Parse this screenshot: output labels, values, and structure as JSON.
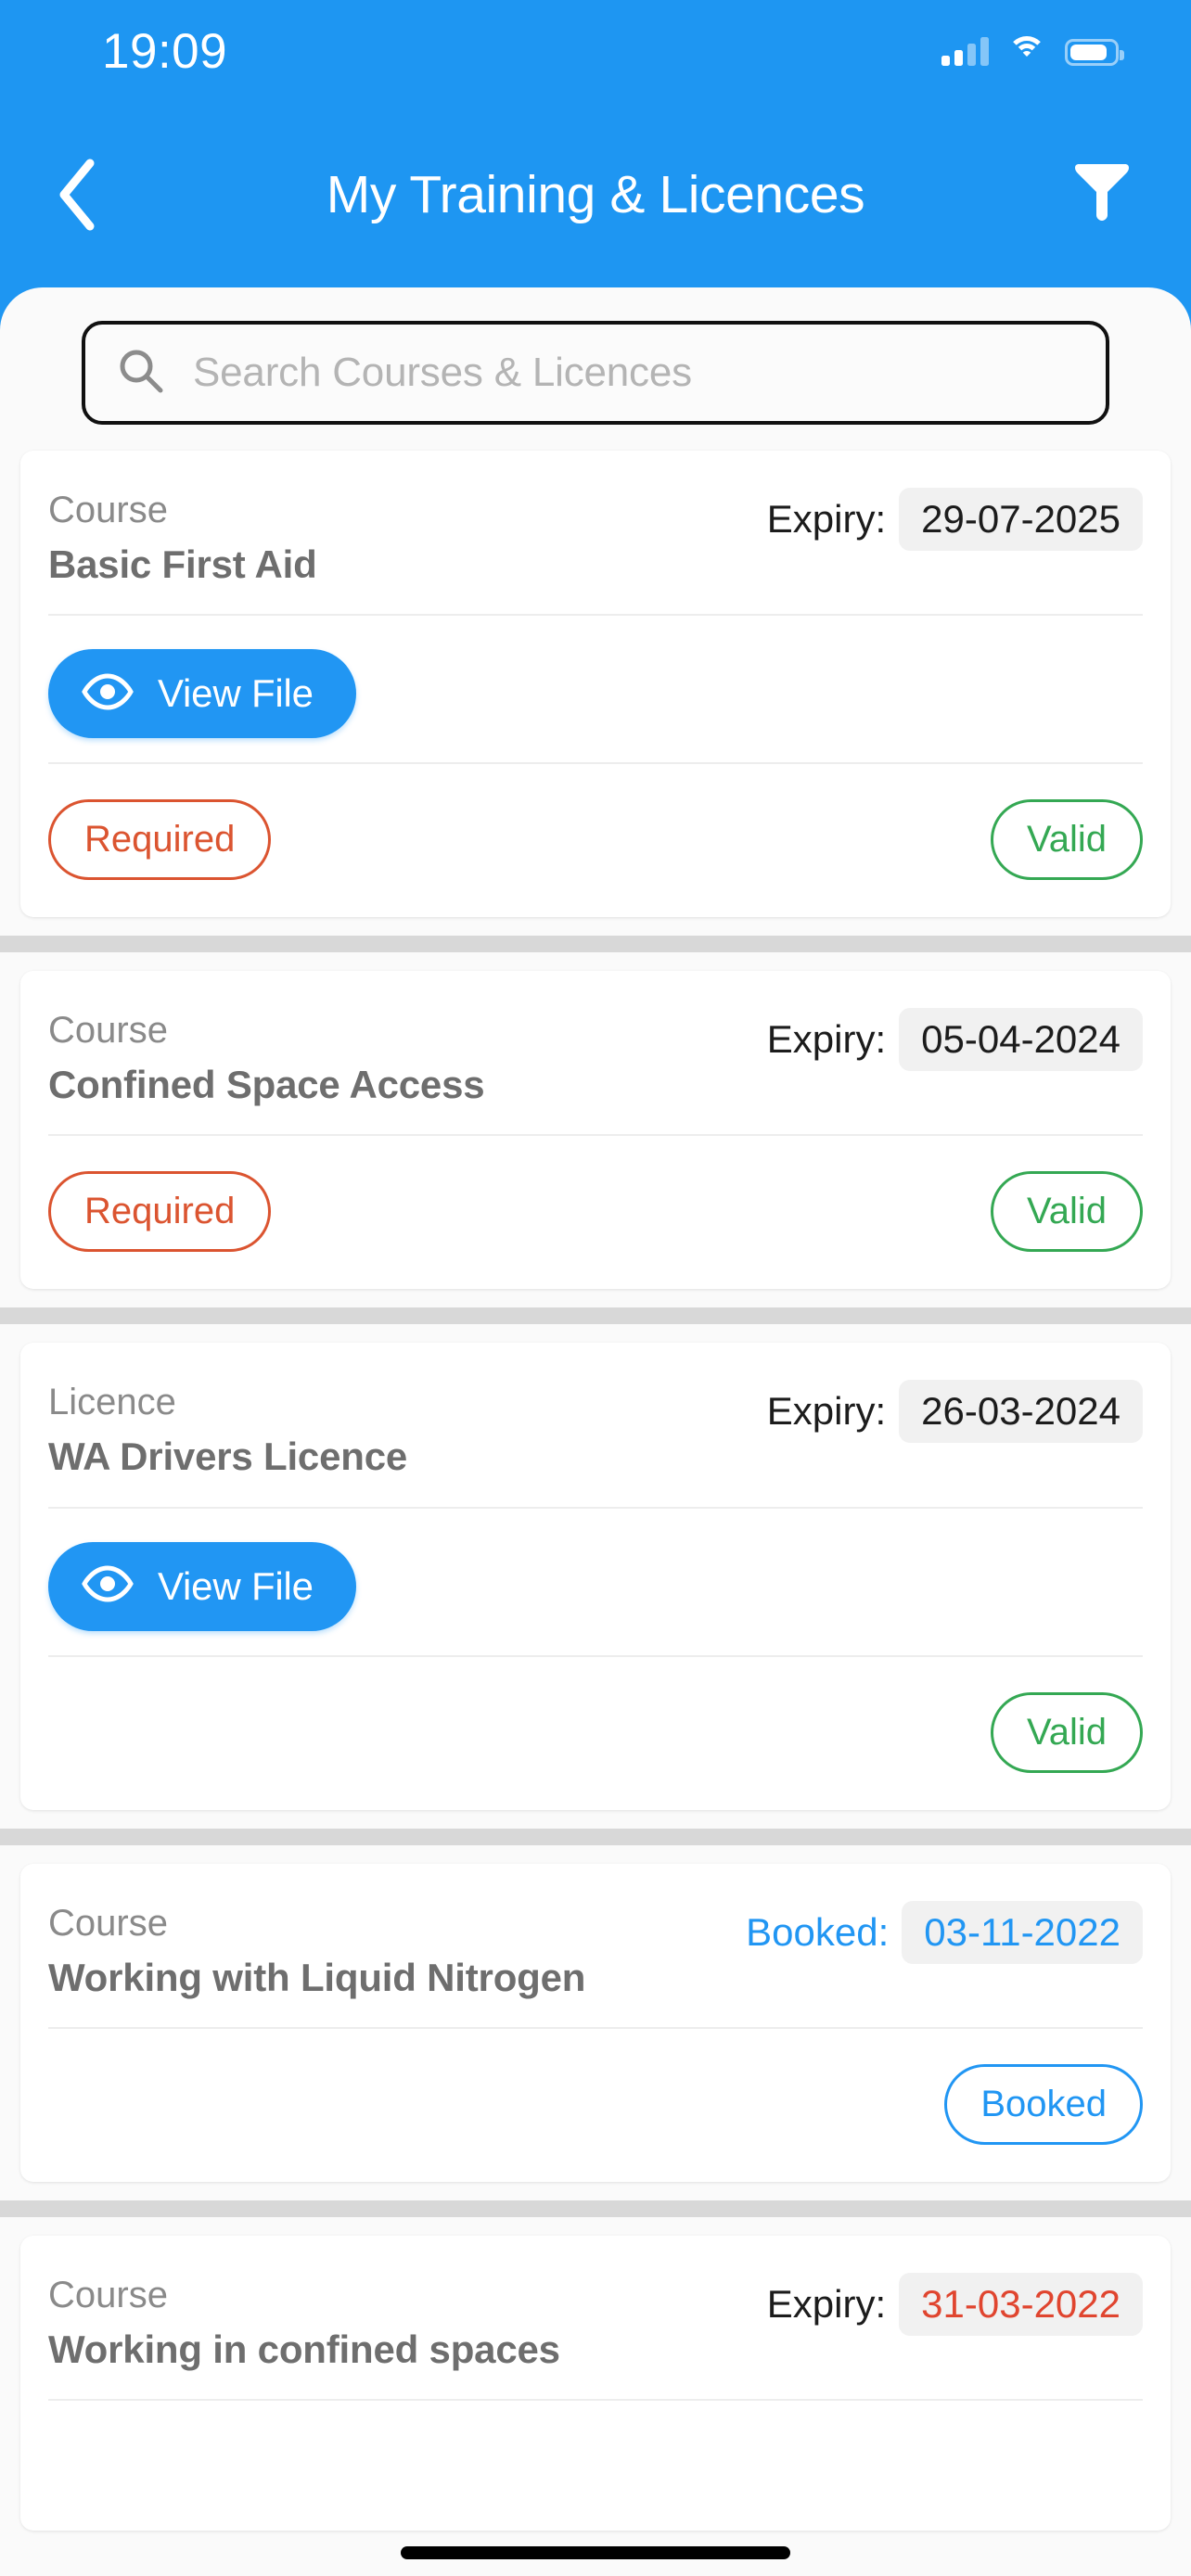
{
  "status_bar": {
    "time": "19:09",
    "signal_icon": "cellular-signal-icon",
    "wifi_icon": "wifi-icon",
    "battery_icon": "battery-icon",
    "signal_bars_filled": 2,
    "signal_bars_total": 4,
    "battery_level_percent": 75
  },
  "header": {
    "title": "My Training & Licences",
    "back_icon": "chevron-left-icon",
    "filter_icon": "filter-funnel-icon",
    "background_color": "#1E96F2"
  },
  "search": {
    "placeholder": "Search Courses & Licences",
    "value": "",
    "icon": "search-icon"
  },
  "colors": {
    "accent_blue": "#2196F3",
    "required_orange": "#DB5430",
    "valid_green": "#34A853",
    "expired_red": "#E0452F",
    "sheet_background": "#FAFAFA",
    "card_background": "#FFFFFF",
    "separator_gray": "#D8D8D8"
  },
  "labels": {
    "view_file": "View File",
    "eye_icon": "eye-icon"
  },
  "cards": [
    {
      "type": "Course",
      "name": "Basic First Aid",
      "date_label": "Expiry:",
      "date_value": "29-07-2025",
      "date_style": "normal",
      "has_view_file": true,
      "view_file_label": "View File",
      "left_badge": "Required",
      "left_badge_style": "required",
      "right_badge": "Valid",
      "right_badge_style": "valid"
    },
    {
      "type": "Course",
      "name": "Confined Space Access",
      "date_label": "Expiry:",
      "date_value": "05-04-2024",
      "date_style": "normal",
      "has_view_file": false,
      "view_file_label": "",
      "left_badge": "Required",
      "left_badge_style": "required",
      "right_badge": "Valid",
      "right_badge_style": "valid"
    },
    {
      "type": "Licence",
      "name": "WA Drivers Licence",
      "date_label": "Expiry:",
      "date_value": "26-03-2024",
      "date_style": "normal",
      "has_view_file": true,
      "view_file_label": "View File",
      "left_badge": "",
      "left_badge_style": "",
      "right_badge": "Valid",
      "right_badge_style": "valid"
    },
    {
      "type": "Course",
      "name": "Working with Liquid Nitrogen",
      "date_label": "Booked:",
      "date_value": "03-11-2022",
      "date_style": "blue",
      "has_view_file": false,
      "view_file_label": "",
      "left_badge": "",
      "left_badge_style": "",
      "right_badge": "Booked",
      "right_badge_style": "booked"
    },
    {
      "type": "Course",
      "name": "Working in confined spaces",
      "date_label": "Expiry:",
      "date_value": "31-03-2022",
      "date_style": "red",
      "has_view_file": false,
      "view_file_label": "",
      "left_badge": "",
      "left_badge_style": "",
      "right_badge": "",
      "right_badge_style": ""
    }
  ],
  "home_indicator": "home-indicator"
}
